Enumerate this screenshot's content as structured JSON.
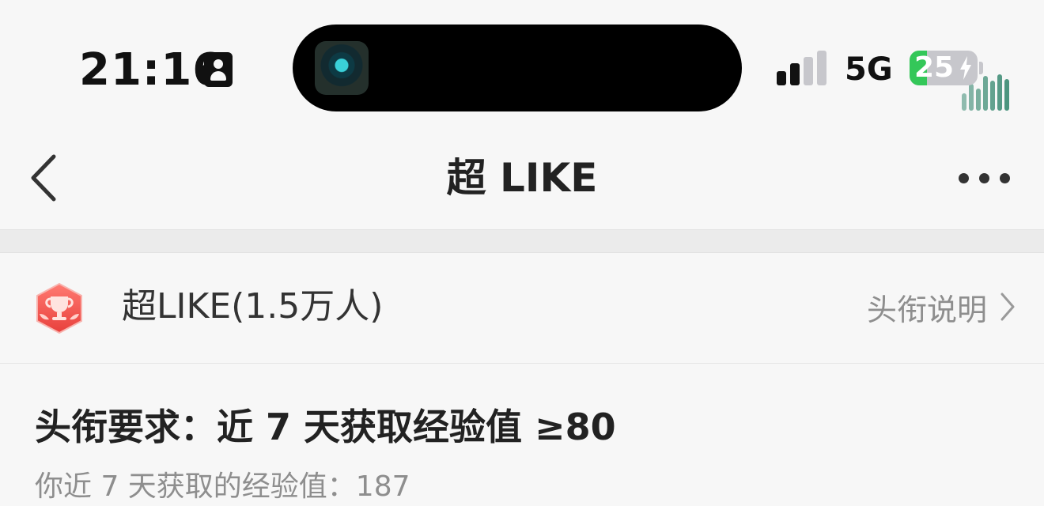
{
  "status_bar": {
    "time": "21:16",
    "network": "5G",
    "battery": "25",
    "battery_level": 0.25,
    "battery_color": "#34c759",
    "icons": [
      "id-badge-icon",
      "cellular-signal-icon",
      "battery-icon",
      "charging-bolt-icon"
    ]
  },
  "dynamic_island": {
    "icons": [
      "media-thumbnail-icon",
      "audio-waveform-icon"
    ]
  },
  "nav": {
    "title": "超 LIKE",
    "back_icon": "chevron-left-icon",
    "more_icon": "more-dots-icon"
  },
  "title_row": {
    "badge_icon": "trophy-badge-icon",
    "name": "超LIKE(1.5万人)",
    "explain_label": "头衔说明",
    "explain_icon": "chevron-right-icon",
    "badge_color": "#f0504d"
  },
  "requirement": {
    "title": "头衔要求：近 7 天获取经验值 ≥80",
    "progress": "你近 7 天获取的经验值：187"
  }
}
